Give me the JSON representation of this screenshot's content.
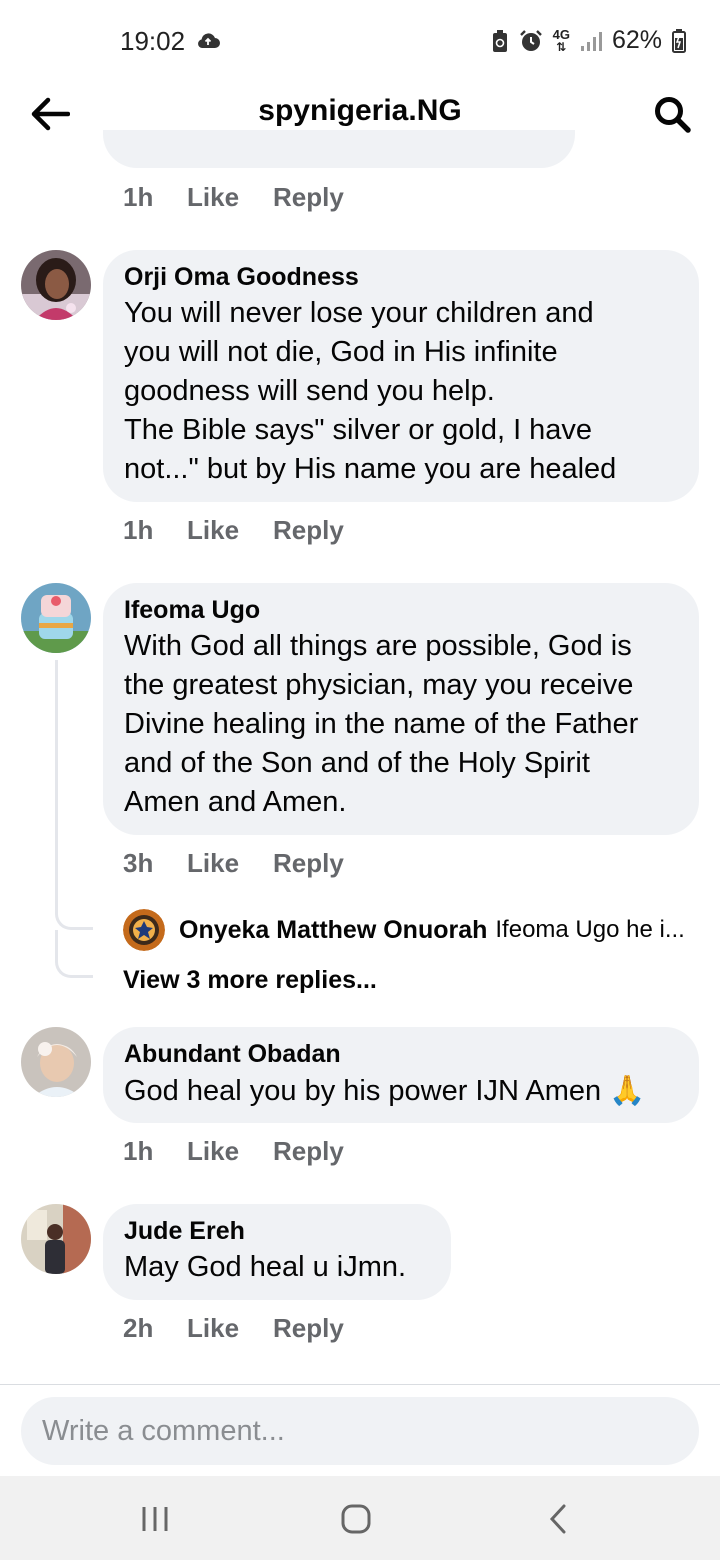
{
  "status_bar": {
    "time": "19:02",
    "network": "4G",
    "battery": "62%",
    "icons": [
      "cloud-icon",
      "battery-saver-icon",
      "alarm-icon",
      "signal-icon",
      "battery-icon"
    ]
  },
  "header": {
    "title": "spynigeria.NG",
    "back_icon": "arrow-left-icon",
    "search_icon": "search-icon"
  },
  "previous_comment": {
    "time": "1h",
    "like_label": "Like",
    "reply_label": "Reply"
  },
  "comments": [
    {
      "author": "Orji Oma Goodness",
      "text": "You will never lose your children  and\nyou will not die, God in His infinite\ngoodness will send you help.\nThe Bible  says\" silver or gold, I have\nnot...\" but by His name you are healed",
      "time": "1h",
      "like_label": "Like",
      "reply_label": "Reply"
    },
    {
      "author": "Ifeoma Ugo",
      "text": "With God all things are possible, God is\nthe greatest physician, may you receive\nDivine healing in the name of the Father\nand of the Son and of the Holy Spirit\nAmen and Amen.",
      "time": "3h",
      "like_label": "Like",
      "reply_label": "Reply",
      "replies_preview": {
        "author": "Onyeka Matthew Onuorah",
        "snippet": "Ifeoma Ugo he i...",
        "view_more_label": "View 3 more replies..."
      }
    },
    {
      "author": "Abundant Obadan",
      "text": "God heal you by his power IJN Amen",
      "emoji": "🙏",
      "time": "1h",
      "like_label": "Like",
      "reply_label": "Reply"
    },
    {
      "author": "Jude Ereh",
      "text": "May God heal u iJmn.",
      "time": "2h",
      "like_label": "Like",
      "reply_label": "Reply"
    }
  ],
  "composer": {
    "placeholder": "Write a comment..."
  },
  "nav_bar": {
    "icons": [
      "recent-apps-icon",
      "home-icon",
      "back-icon"
    ]
  },
  "colors": {
    "bubble": "#f0f2f5",
    "secondary_text": "#65676b",
    "primary_text": "#050505",
    "nav_bar": "#f1f1f1"
  }
}
